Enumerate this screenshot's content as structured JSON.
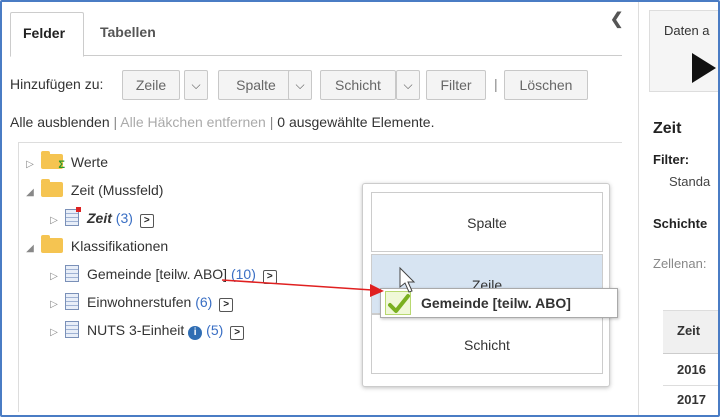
{
  "tabs": {
    "active": "Felder",
    "inactive": "Tabellen"
  },
  "toolbar": {
    "add_to_label": "Hinzufügen zu:",
    "row": "Zeile",
    "column": "Spalte",
    "layer": "Schicht",
    "filter": "Filter",
    "separator": "|",
    "delete": "Löschen"
  },
  "links": {
    "hide_all": "Alle ausblenden",
    "sep1": "|",
    "remove_checks": "Alle Häkchen entfernen",
    "sep2": "|",
    "selected_count": "0 ausgewählte Elemente."
  },
  "tree": {
    "werte": "Werte",
    "zeit_folder": "Zeit (Mussfeld)",
    "zeit_item": "Zeit",
    "zeit_count": "(3)",
    "klassifikationen": "Klassifikationen",
    "gemeinde": "Gemeinde [teilw. ABO]",
    "gemeinde_count": "(10)",
    "einwohner": "Einwohnerstufen",
    "einwohner_count": "(6)",
    "nuts": "NUTS 3-Einheit",
    "nuts_count": "(5)",
    "expand_glyph": ">"
  },
  "popup": {
    "spalte": "Spalte",
    "zeile": "Zeile",
    "schicht": "Schicht"
  },
  "drag_chip": {
    "label": "Gemeinde [teilw. ABO]"
  },
  "right_panel": {
    "data_label": "Daten a",
    "heading": "Zeit",
    "filter_label": "Filter:",
    "filter_value": "Standa",
    "layers_label": "Schichte",
    "cells_label": "Zellenan:",
    "table_head": "Zeit",
    "rows": [
      "2016",
      "2017"
    ]
  },
  "colors": {
    "frame": "#4a7cc4",
    "count": "#3a6fc4",
    "highlight": "#d7e4f2",
    "arrow": "#e02020",
    "folder": "#f5c451"
  }
}
